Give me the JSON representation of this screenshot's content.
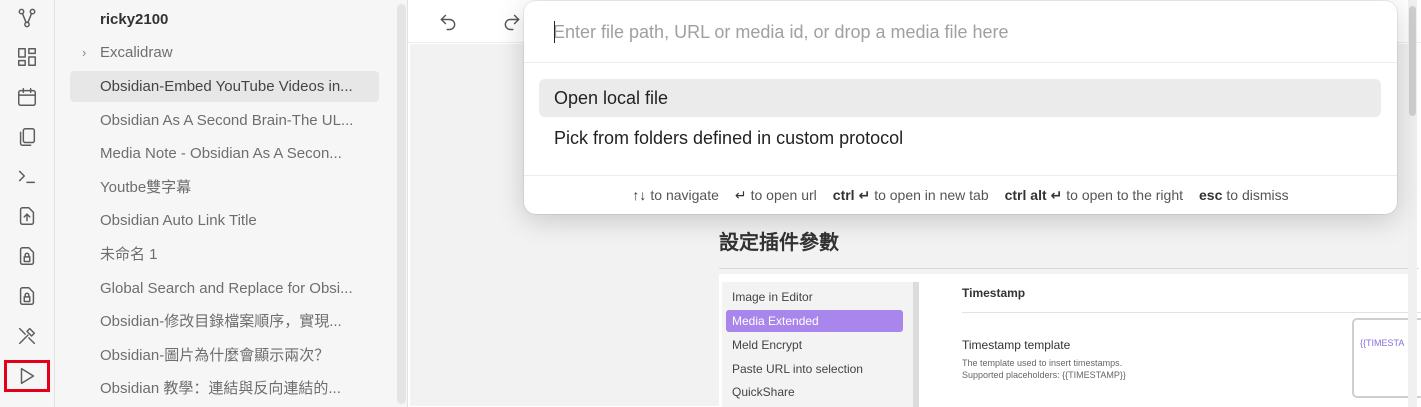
{
  "ribbon": {
    "icons": [
      "graph-view-icon",
      "canvas-icon",
      "daily-note-icon",
      "copy-icon",
      "terminal-icon",
      "export-icon",
      "lock-icon",
      "lock-icon",
      "tools-icon",
      "play-icon"
    ]
  },
  "explorer": {
    "vault_name": "ricky2100",
    "folder": "Excalidraw",
    "files": [
      "Obsidian-Embed YouTube Videos in...",
      "Obsidian As A Second Brain-The UL...",
      "Media Note - Obsidian As A Secon...",
      "Youtbe雙字幕",
      "Obsidian Auto Link Title",
      "未命名 1",
      "Global Search and Replace for Obsi...",
      "Obsidian-修改目錄檔案順序，實現...",
      "Obsidian-圖片為什麼會顯示兩次？",
      "Obsidian 教學：連結與反向連結的..."
    ],
    "active_file_index": 0
  },
  "editor": {
    "heading": "設定插件參數",
    "embedded_settings": {
      "plugins": [
        "Image in Editor",
        "Media Extended",
        "Meld Encrypt",
        "Paste URL into selection",
        "QuickShare"
      ],
      "selected_plugin": "Media Extended",
      "section_title": "Timestamp",
      "setting_name": "Timestamp template",
      "setting_desc_1": "The template used to insert timestamps.",
      "setting_desc_2": "Supported placeholders: {{TIMESTAMP}}",
      "setting_value": "{{TIMESTA"
    }
  },
  "modal": {
    "placeholder": "Enter file path, URL or media id, or drop a media file here",
    "suggestions": [
      "Open local file",
      "Pick from folders defined in custom protocol"
    ],
    "hints": [
      {
        "key": "↑↓",
        "text": "to navigate"
      },
      {
        "key": "↵",
        "text": "to open url"
      },
      {
        "key": "ctrl ↵",
        "text": "to open in new tab"
      },
      {
        "key": "ctrl alt ↵",
        "text": "to open to the right"
      },
      {
        "key": "esc",
        "text": "to dismiss"
      }
    ]
  },
  "colors": {
    "accent": "#a986ec",
    "highlight_box": "#e3001b"
  }
}
